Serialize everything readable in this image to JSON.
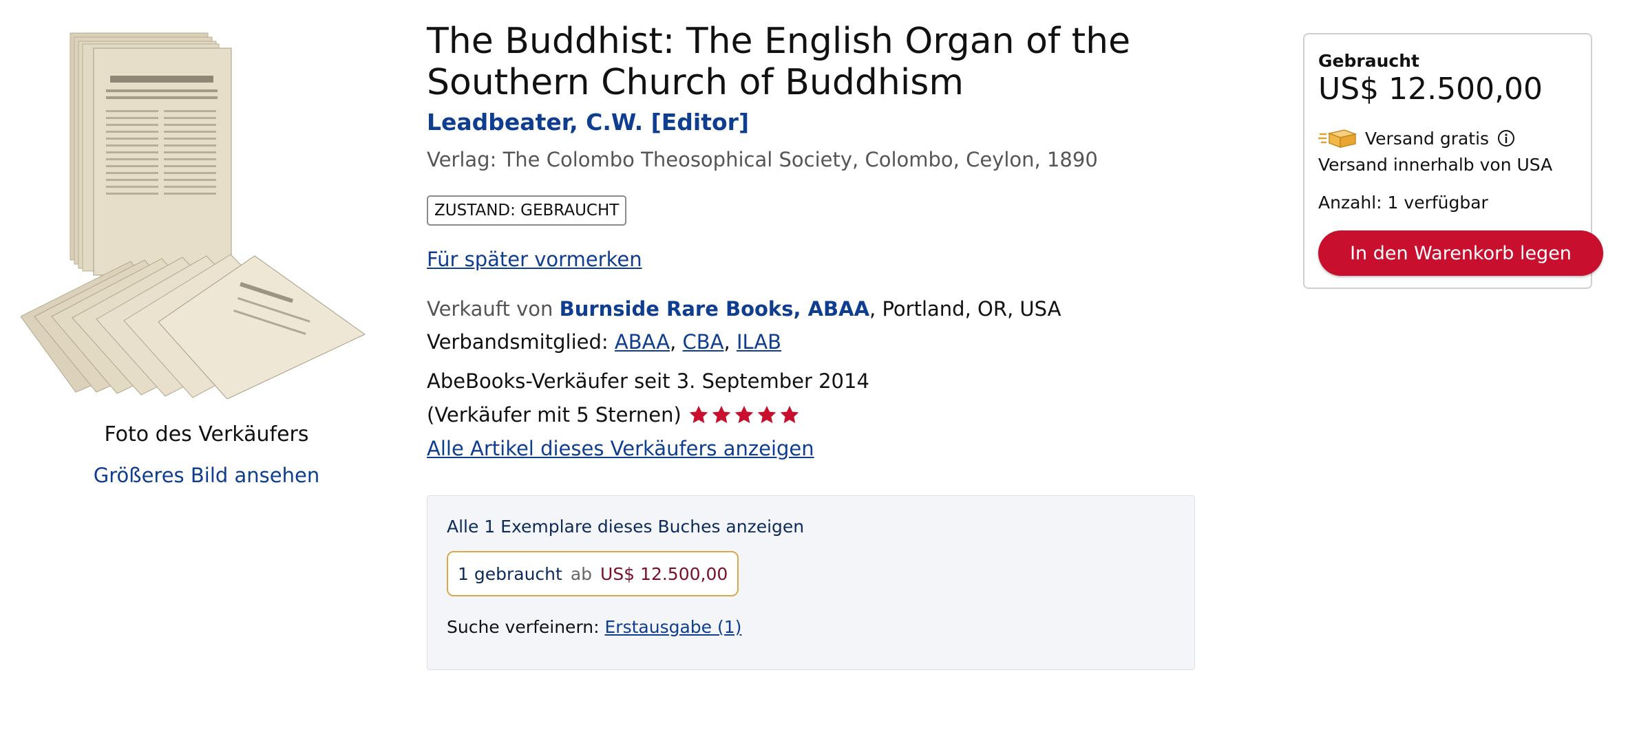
{
  "image_panel": {
    "caption": "Foto des Verkäufers",
    "larger_image_link": "Größeres Bild ansehen"
  },
  "book": {
    "title": "The Buddhist: The English Organ of the Southern Church of Buddhism",
    "author": "Leadbeater, C.W. [Editor]",
    "publisher": "Verlag: The Colombo Theosophical Society, Colombo, Ceylon, 1890",
    "condition_badge": "ZUSTAND: GEBRAUCHT",
    "watchlist_link": "Für später vormerken"
  },
  "seller": {
    "sold_by_prefix": "Verkauft von",
    "name": "Burnside Rare Books, ABAA",
    "location": ", Portland, OR, USA",
    "association_prefix": "Verbandsmitglied:",
    "associations": [
      "ABAA",
      "CBA",
      "ILAB"
    ],
    "since": "AbeBooks-Verkäufer seit 3. September 2014",
    "rating_text": "(Verkäufer mit 5 Sternen)",
    "rating_stars": 5,
    "star_color": "#c8102e",
    "all_items_link": "Alle Artikel dieses Verkäufers anzeigen"
  },
  "copies": {
    "heading": "Alle 1 Exemplare dieses Buches anzeigen",
    "chip_used": "1 gebraucht",
    "chip_from": "ab",
    "chip_price": "US$ 12.500,00",
    "refine_prefix": "Suche verfeinern:",
    "refine_link": "Erstausgabe (1)"
  },
  "buy_box": {
    "condition": "Gebraucht",
    "price": "US$ 12.500,00",
    "shipping": "Versand gratis",
    "shipping_icon": "truck-icon",
    "shipping_region": "Versand innerhalb von USA",
    "quantity": "Anzahl: 1 verfügbar",
    "add_to_cart": "In den Warenkorb legen",
    "accent_color": "#c8102e"
  }
}
